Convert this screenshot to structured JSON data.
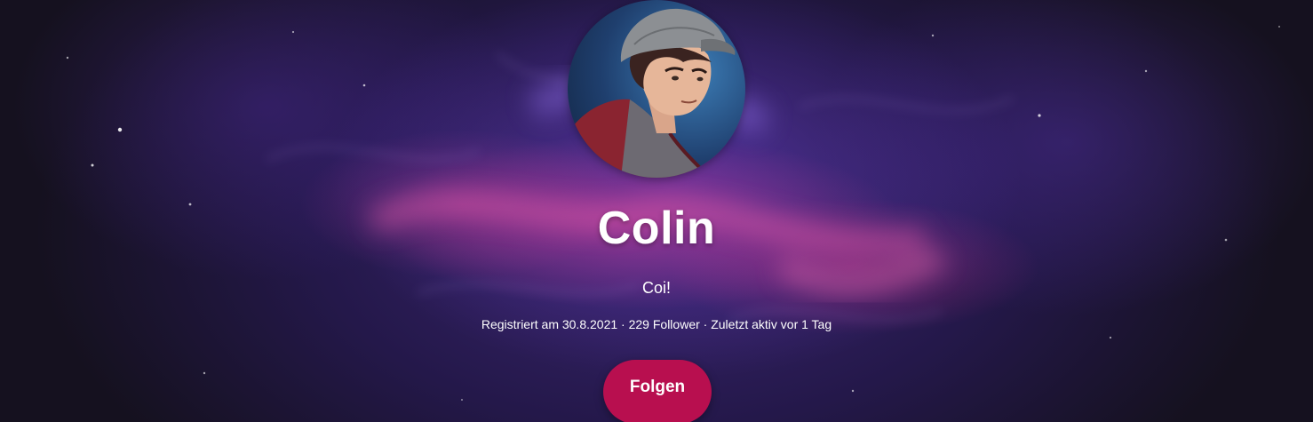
{
  "profile": {
    "name": "Colin",
    "bio": "Coi!",
    "meta": {
      "registered": "Registriert am 30.8.2021",
      "followers": "229 Follower",
      "last_active": "Zuletzt aktiv vor 1 Tag",
      "separator": " · "
    },
    "follow_label": "Folgen",
    "avatar_icon": "profile-avatar-illustration"
  },
  "colors": {
    "accent": "#b80f4f",
    "background_dark": "#15111f",
    "nebula_purple": "#3a2670",
    "nebula_pink": "#d63c96",
    "text": "#ffffff"
  }
}
